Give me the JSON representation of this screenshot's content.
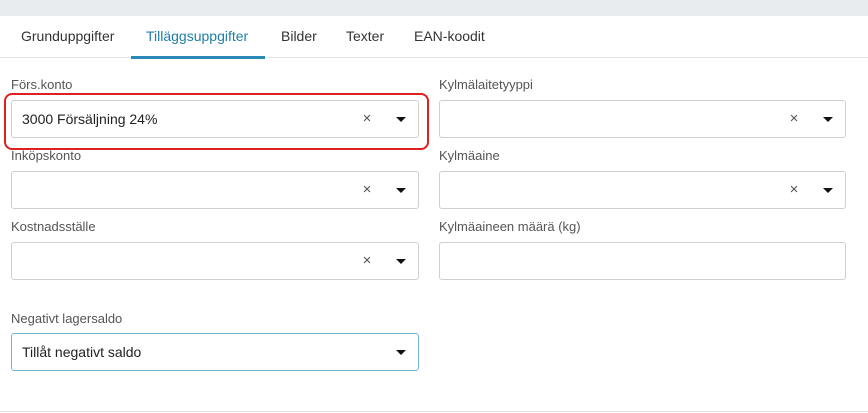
{
  "tabs": [
    {
      "label": "Grunduppgifter",
      "active": false
    },
    {
      "label": "Tilläggsuppgifter",
      "active": true
    },
    {
      "label": "Bilder",
      "active": false
    },
    {
      "label": "Texter",
      "active": false
    },
    {
      "label": "EAN-koodit",
      "active": false
    }
  ],
  "left_fields": {
    "sales_account": {
      "label": "Förs.konto",
      "value": "3000 Försäljning 24%",
      "clear_icon": "close-icon",
      "dropdown_icon": "caret-down-icon"
    },
    "purchase_account": {
      "label": "Inköpskonto",
      "value": ""
    },
    "cost_center": {
      "label": "Kostnadsställe",
      "value": ""
    },
    "negative_stock": {
      "label": "Negativt lagersaldo",
      "value": "Tillåt negativt saldo"
    }
  },
  "right_fields": {
    "cooling_device_type": {
      "label": "Kylmälaitetyyppi",
      "value": ""
    },
    "refrigerant": {
      "label": "Kylmäaine",
      "value": ""
    },
    "refrigerant_amount": {
      "label": "Kylmäaineen määrä (kg)",
      "value": ""
    }
  },
  "icons": {
    "clear": "×"
  },
  "colors": {
    "accent": "#2a8ab6",
    "highlight": "#e02020"
  }
}
